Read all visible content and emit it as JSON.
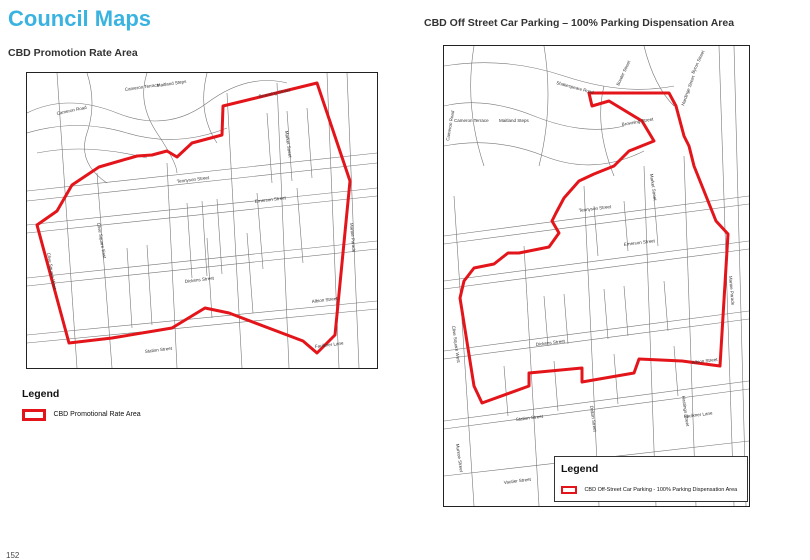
{
  "page": {
    "title": "Council Maps",
    "page_number": "152"
  },
  "left_map": {
    "heading": "CBD Promotion Rate Area",
    "streets": {
      "cameron_road": "Cameron Road",
      "cameron_terrace": "Cameron Terrace",
      "maitland_steps": "Maitland Steps",
      "browning_street": "Browning Street",
      "tennyson_street": "Tennyson Street",
      "market_street": "Market Street",
      "emerson_street": "Emerson Street",
      "dickens_street": "Dickens Street",
      "albion_street": "Albion Street",
      "station_street": "Station Street",
      "clive_square_west": "Clive Square West",
      "clive_square_east": "Clive Square East",
      "marine_parade": "Marine Parade",
      "faulkner_lane": "Faulkner Lane",
      "carlyle_street": "Carlyle Street",
      "milton_road": "Milton Road",
      "raffles_street": "Raffles Street",
      "hastings_street": "Hastings Street",
      "dalton_street": "Dalton Street",
      "shakespeare_road": "Shakespeare Road"
    },
    "legend": {
      "title": "Legend",
      "item": "CBD Promotional Rate Area"
    },
    "boundary_color": "#e3151a"
  },
  "right_map": {
    "heading": "CBD Off Street Car Parking – 100% Parking Dispensation Area",
    "streets": {
      "shakespeare_road": "Shakespeare Road",
      "bowler_street": "Bowler Street",
      "cameron_road": "Cameron Road",
      "cameron_terrace": "Cameron Terrace",
      "maitland_steps": "Maitland Steps",
      "browning_street": "Browning Street",
      "tennyson_street": "Tennyson Street",
      "emerson_street": "Emerson Street",
      "market_street": "Market Street",
      "clive_square_west": "Clive Square West",
      "dickens_street": "Dickens Street",
      "albion_street": "Albion Street",
      "marine_parade": "Marine Parade",
      "hastings_street": "Hastings Street",
      "station_street": "Station Street",
      "dalton_street": "Dalton Street",
      "faulkner_lane": "Faulkner Lane",
      "vautier_street": "Vautier Street",
      "munroe_street": "Munroe Street",
      "byron_street": "Byron Street",
      "hardinge_street": "Hardinge Street"
    },
    "legend": {
      "title": "Legend",
      "item": "CBD Off-Street Car Parking - 100% Parking Dispensation Area"
    },
    "boundary_color": "#e3151a"
  }
}
